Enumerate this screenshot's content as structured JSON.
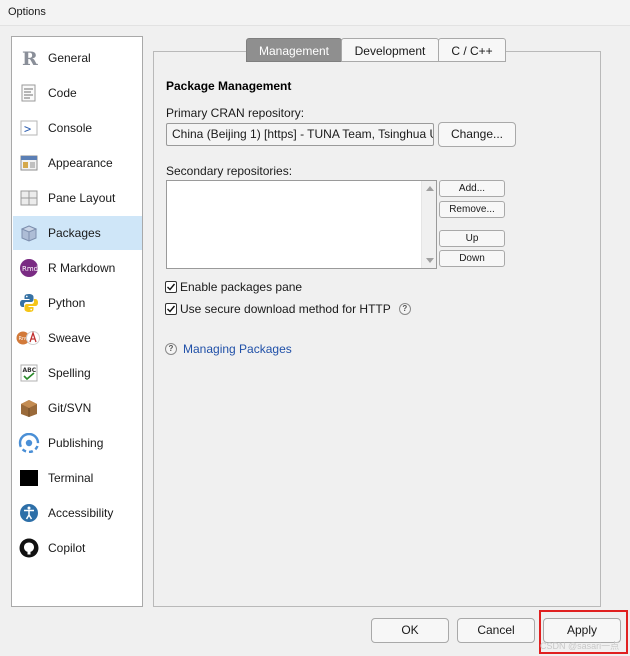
{
  "window": {
    "title": "Options"
  },
  "sidebar": {
    "items": [
      {
        "label": "General",
        "icon": "r-logo-icon"
      },
      {
        "label": "Code",
        "icon": "code-icon"
      },
      {
        "label": "Console",
        "icon": "console-icon"
      },
      {
        "label": "Appearance",
        "icon": "appearance-icon"
      },
      {
        "label": "Pane Layout",
        "icon": "pane-layout-icon"
      },
      {
        "label": "Packages",
        "icon": "packages-icon",
        "selected": true
      },
      {
        "label": "R Markdown",
        "icon": "rmarkdown-icon"
      },
      {
        "label": "Python",
        "icon": "python-icon"
      },
      {
        "label": "Sweave",
        "icon": "sweave-icon"
      },
      {
        "label": "Spelling",
        "icon": "spelling-icon"
      },
      {
        "label": "Git/SVN",
        "icon": "git-svn-icon"
      },
      {
        "label": "Publishing",
        "icon": "publishing-icon"
      },
      {
        "label": "Terminal",
        "icon": "terminal-icon"
      },
      {
        "label": "Accessibility",
        "icon": "accessibility-icon"
      },
      {
        "label": "Copilot",
        "icon": "github-icon"
      }
    ]
  },
  "tabs": [
    {
      "label": "Management",
      "active": true
    },
    {
      "label": "Development"
    },
    {
      "label": "C / C++"
    }
  ],
  "management": {
    "section_title": "Package Management",
    "primary_repo_label": "Primary CRAN repository:",
    "primary_repo_value": "China (Beijing 1) [https] - TUNA Team, Tsinghua U",
    "change_button": "Change...",
    "secondary_repo_label": "Secondary repositories:",
    "add_button": "Add...",
    "remove_button": "Remove...",
    "up_button": "Up",
    "down_button": "Down",
    "enable_pane_label": "Enable packages pane",
    "enable_pane_checked": true,
    "secure_download_label": "Use secure download method for HTTP",
    "secure_download_checked": true,
    "help_glyph": "?",
    "managing_link": "Managing Packages"
  },
  "footer": {
    "ok_button": "OK",
    "cancel_button": "Cancel",
    "apply_button": "Apply"
  },
  "watermark": "CSDN @sasari一点",
  "colors": {
    "selected_item": "#cfe6f8",
    "active_tab": "#8f8f8f",
    "link": "#2050a8",
    "highlight": "#e02020"
  }
}
